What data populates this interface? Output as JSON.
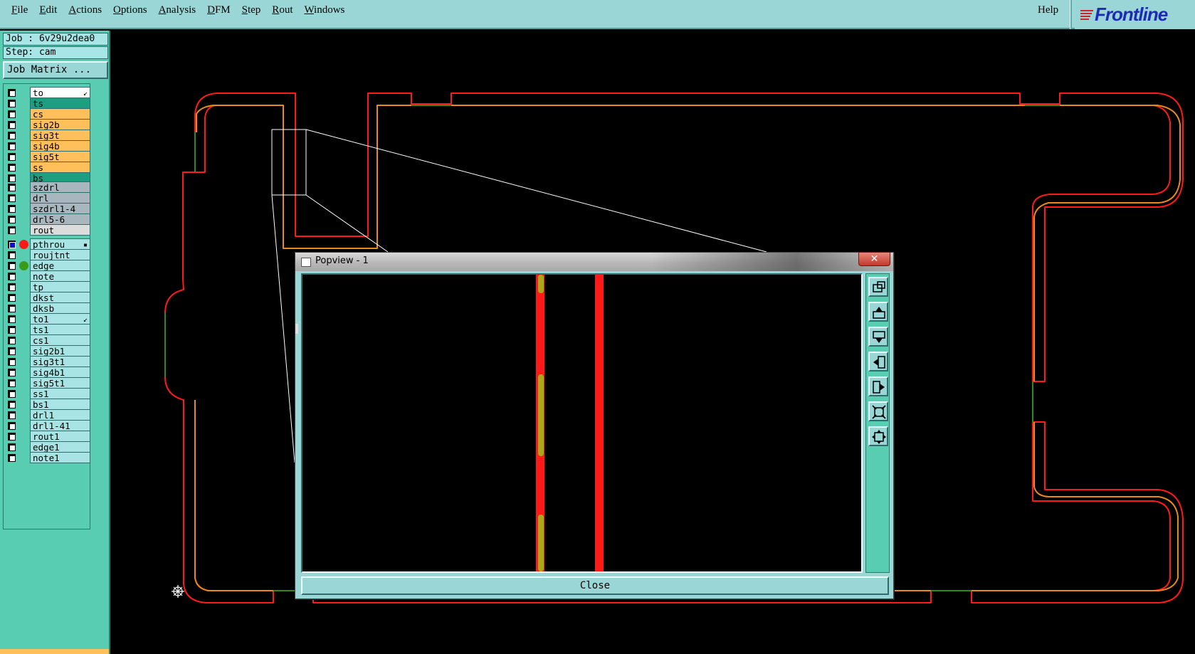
{
  "menubar": {
    "items": [
      {
        "label": "File",
        "accel_index": 0
      },
      {
        "label": "Edit",
        "accel_index": 0
      },
      {
        "label": "Actions",
        "accel_index": 0
      },
      {
        "label": "Options",
        "accel_index": 0
      },
      {
        "label": "Analysis",
        "accel_index": 0
      },
      {
        "label": "DFM",
        "accel_index": 0
      },
      {
        "label": "Step",
        "accel_index": 0
      },
      {
        "label": "Rout",
        "accel_index": 0
      },
      {
        "label": "Windows",
        "accel_index": 0
      }
    ],
    "help": "Help",
    "logo_text": "Frontline"
  },
  "left_panel": {
    "job": "Job : 6v29u2dea0",
    "step": "Step: cam",
    "job_matrix_button": "Job Matrix ...",
    "groups": [
      {
        "layers": [
          {
            "name": "to",
            "bg": "sel",
            "flag": "↙"
          },
          {
            "name": "ts",
            "bg": "green"
          },
          {
            "name": "cs",
            "bg": "orange"
          },
          {
            "name": "sig2b",
            "bg": "orange"
          },
          {
            "name": "sig3t",
            "bg": "orange"
          },
          {
            "name": "sig4b",
            "bg": "orange"
          },
          {
            "name": "sig5t",
            "bg": "orange"
          },
          {
            "name": "ss",
            "bg": "orange"
          },
          {
            "name": "bs",
            "bg": "green"
          }
        ]
      },
      {
        "layers": [
          {
            "name": "szdrl",
            "bg": "grey"
          },
          {
            "name": "drl",
            "bg": "grey"
          },
          {
            "name": "szdrl1-4",
            "bg": "grey"
          },
          {
            "name": "drl5-6",
            "bg": "grey"
          },
          {
            "name": "rout",
            "bg": "light"
          }
        ]
      },
      {
        "layers": [
          {
            "name": "pthrou",
            "bg": "cyan",
            "checked": true,
            "dot": "#ff1a1a",
            "flag": "▪"
          },
          {
            "name": "roujtnt",
            "bg": "cyan"
          },
          {
            "name": "edge",
            "bg": "cyan",
            "dot": "#3a9a1a"
          },
          {
            "name": "note",
            "bg": "cyan"
          },
          {
            "name": "tp",
            "bg": "cyan"
          },
          {
            "name": "dkst",
            "bg": "cyan"
          },
          {
            "name": "dksb",
            "bg": "cyan"
          },
          {
            "name": "to1",
            "bg": "cyan",
            "flag": "↙"
          },
          {
            "name": "ts1",
            "bg": "cyan"
          },
          {
            "name": "cs1",
            "bg": "cyan"
          },
          {
            "name": "sig2b1",
            "bg": "cyan"
          },
          {
            "name": "sig3t1",
            "bg": "cyan"
          },
          {
            "name": "sig4b1",
            "bg": "cyan"
          },
          {
            "name": "sig5t1",
            "bg": "cyan"
          },
          {
            "name": "ss1",
            "bg": "cyan"
          },
          {
            "name": "bs1",
            "bg": "cyan"
          },
          {
            "name": "drl1",
            "bg": "cyan"
          },
          {
            "name": "drl1-41",
            "bg": "cyan"
          },
          {
            "name": "rout1",
            "bg": "cyan"
          },
          {
            "name": "edge1",
            "bg": "cyan"
          },
          {
            "name": "note1",
            "bg": "cyan"
          }
        ]
      }
    ]
  },
  "popview": {
    "title": "Popview - 1",
    "close_x": "✕",
    "close_button": "Close",
    "tools": [
      "zoom-window-icon",
      "pan-up-icon",
      "pan-down-icon",
      "pan-left-icon",
      "pan-right-icon",
      "zoom-home-icon",
      "fit-view-icon"
    ]
  },
  "colors": {
    "menubar": "#9ad6d6",
    "panel": "#59cdb2",
    "outline_red": "#ff1a1a",
    "outline_orange": "#e88a1a",
    "edge_green": "#2a8a1a",
    "logo_blue": "#1d2bb5"
  }
}
